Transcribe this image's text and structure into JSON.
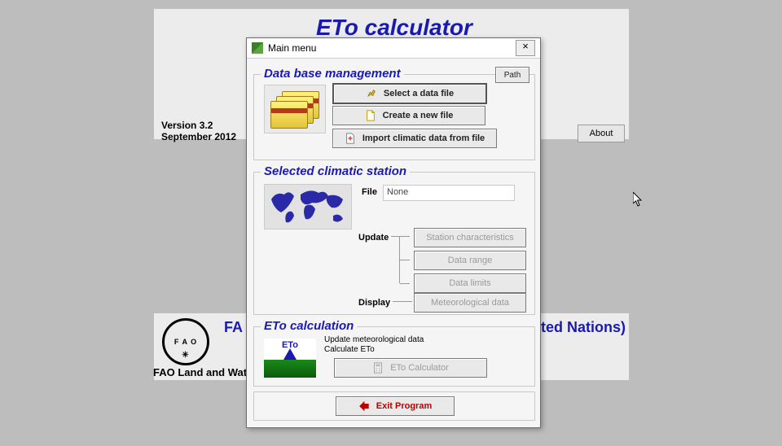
{
  "background": {
    "app_title": "ETo calculator",
    "version_line1": "Version 3.2",
    "version_line2": "September 2012",
    "about_label": "About",
    "org_prefix": "FA",
    "org_suffix": "ted Nations)",
    "footer": "FAO Land and Water",
    "fao_badge": "F A O"
  },
  "window": {
    "title": "Main menu",
    "close": "×"
  },
  "dbm": {
    "legend": "Data base management",
    "path_btn": "Path",
    "select_btn": "Select a data file",
    "create_btn": "Create a new file",
    "import_btn": "Import climatic data from file"
  },
  "scs": {
    "legend": "Selected climatic station",
    "file_label": "File",
    "file_value": "None",
    "update_label": "Update",
    "display_label": "Display",
    "btn_char": "Station characteristics",
    "btn_range": "Data range",
    "btn_limits": "Data limits",
    "btn_met": "Meteorological data"
  },
  "calc": {
    "legend": "ETo calculation",
    "hint1": "Update meteorological data",
    "hint2": "Calculate ETo",
    "eto_text": "ETo",
    "calc_btn": "ETo Calculator"
  },
  "exit": {
    "label": "Exit Program"
  }
}
